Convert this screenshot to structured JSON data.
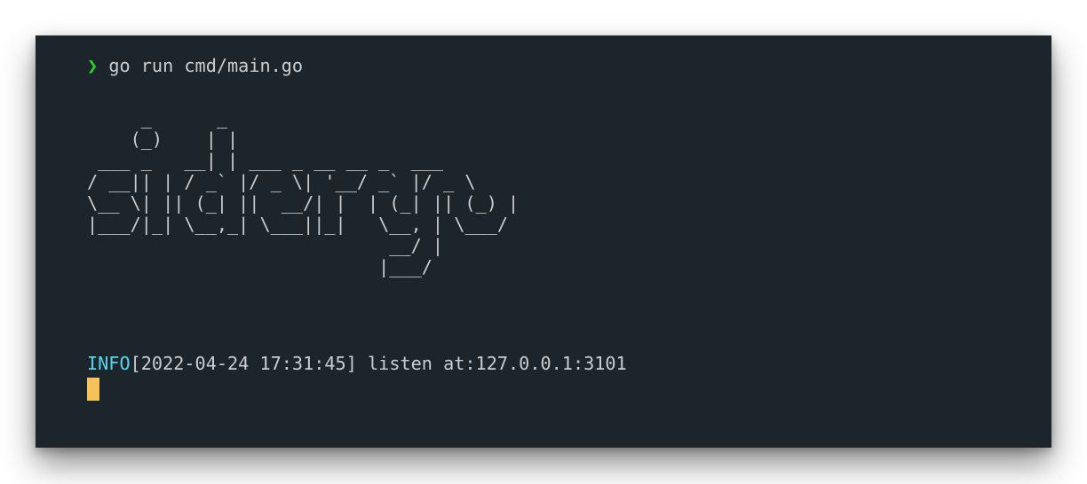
{
  "terminal": {
    "prompt_symbol": "❯",
    "command": "go run cmd/main.go",
    "banner_art": "     _      _\n    (_)    | |\n ___ _   __| | ___ _ __ __ _  ___\n/ __|| | / _` |/ _ \\| '__/ _` |/ _ \\\n\\__ \\| || (_| ||  __/| |  | (_| || (_) |\n|___/|_| \\__,_| \\___||_|   \\__, | \\___/\n                            __/ |\n                           |___/",
    "log": {
      "level": "INFO",
      "timestamp": "[2022-04-24 17:31:45]",
      "message": "listen at:127.0.0.1:3101"
    }
  },
  "colors": {
    "background": "#1c252b",
    "foreground": "#c9ced3",
    "prompt_arrow": "#2ad12a",
    "log_level": "#55d6f0",
    "cursor": "#f7c15a"
  }
}
